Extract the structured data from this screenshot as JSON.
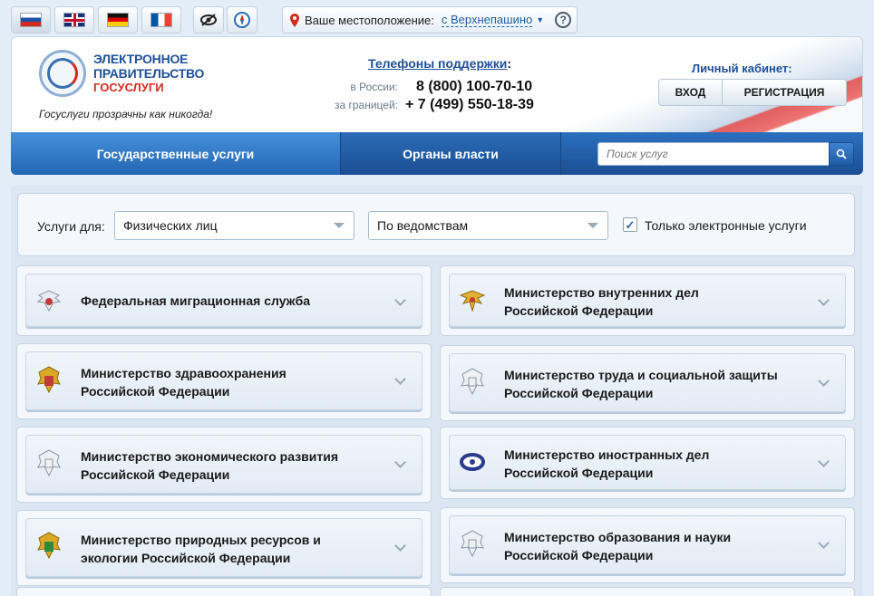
{
  "languages": [
    {
      "code": "ru",
      "icon": "flag-russia-icon",
      "active": true
    },
    {
      "code": "en",
      "icon": "flag-uk-icon",
      "active": false
    },
    {
      "code": "de",
      "icon": "flag-germany-icon",
      "active": false
    },
    {
      "code": "fr",
      "icon": "flag-france-icon",
      "active": false
    }
  ],
  "tools": {
    "accessibility_icon": "eye-icon",
    "compass_icon": "compass-icon"
  },
  "location": {
    "label": "Ваше местоположение:",
    "city": "с Верхнепашино",
    "help": "?"
  },
  "logo": {
    "line1": "ЭЛЕКТРОННОЕ",
    "line2": "ПРАВИТЕЛЬСТВО",
    "line3": "ГОСУСЛУГИ",
    "tagline": "Госуслуги прозрачны как никогда!"
  },
  "support": {
    "title": "Телефоны поддержки",
    "colon": ":",
    "russia_label": "в России:",
    "russia_phone": "8 (800) 100-70-10",
    "abroad_label": "за границей:",
    "abroad_phone": "+ 7 (499) 550-18-39"
  },
  "cabinet": {
    "title": "Личный кабинет:",
    "login": "ВХОД",
    "register": "РЕГИСТРАЦИЯ"
  },
  "nav": {
    "tab1": "Государственные услуги",
    "tab2": "Органы власти",
    "search_placeholder": "Поиск услуг"
  },
  "filters": {
    "label": "Услуги для:",
    "audience": "Физических лиц",
    "grouping": "По ведомствам",
    "electronic_only": "Только электронные услуги",
    "electronic_only_checked": true
  },
  "agencies": [
    {
      "name": "Федеральная миграционная служба",
      "icon": "fms-emblem-icon"
    },
    {
      "name": "Министерство внутренних дел\nРоссийской Федерации",
      "icon": "mvd-emblem-icon"
    },
    {
      "name": "Министерство здравоохранения\nРоссийской Федерации",
      "icon": "minzdrav-emblem-icon"
    },
    {
      "name": "Министерство труда и социальной защиты\nРоссийской Федерации",
      "icon": "mintrud-emblem-icon"
    },
    {
      "name": "Министерство экономического развития\nРоссийской Федерации",
      "icon": "minekonom-emblem-icon"
    },
    {
      "name": "Министерство иностранных дел\nРоссийской Федерации",
      "icon": "mid-emblem-icon"
    },
    {
      "name": "Министерство природных ресурсов и\nэкологии Российской Федерации",
      "icon": "minprirody-emblem-icon"
    },
    {
      "name": "Министерство образования и науки\nРоссийской Федерации",
      "icon": "minobrnauki-emblem-icon"
    }
  ],
  "colors": {
    "brand_blue": "#1f4f9a",
    "brand_red": "#d52b1e",
    "nav_blue": "#2466b3"
  }
}
